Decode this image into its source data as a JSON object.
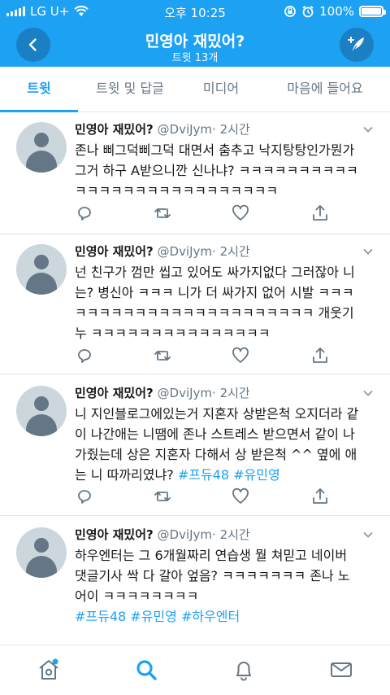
{
  "status_bar": {
    "carrier": "LG U+",
    "time": "오후 10:25",
    "battery": "100%",
    "battery_level": 1.0
  },
  "header": {
    "title": "민영아 재밌어?",
    "subtitle": "트윗 13개"
  },
  "tabs": [
    {
      "label": "트윗",
      "active": true
    },
    {
      "label": "트윗 및 답글",
      "active": false
    },
    {
      "label": "미디어",
      "active": false
    },
    {
      "label": "마음에 들어요",
      "active": false
    }
  ],
  "tweets": [
    {
      "name": "민영아 재밌어?",
      "handle": "@DviJym",
      "time": "· 2시간",
      "lines": [
        "존나 삐그덕삐그덕 대면서 춤추고 낙지탕탕인가뭔가",
        "그거 하구 A받으니깐 신나냐? ㅋㅋㅋㅋㅋㅋㅋㅋㅋㅋ",
        "ㅋㅋㅋㅋㅋㅋㅋㅋㅋㅋㅋㅋㅋㅋㅋㅋㅋ"
      ],
      "hashtags": ""
    },
    {
      "name": "민영아 재밌어?",
      "handle": "@DviJym",
      "time": "· 2시간",
      "lines": [
        "넌 친구가 껌만 씹고 있어도 싸가지없다 그러잖아 니",
        "는? 병신아 ㅋㅋㅋ 니가 더 싸가지 없어 시발 ㅋㅋㅋ",
        "ㅋㅋㅋㅋㅋㅋㅋㅋㅋㅋㅋㅋㅋㅋㅋㅋㅋㅋㅋㅋ 개웃기",
        "누 ㅋㅋㅋㅋㅋㅋㅋㅋㅋㅋㅋㅋㅋㅋㅋ"
      ],
      "hashtags": ""
    },
    {
      "name": "민영아 재밌어?",
      "handle": "@DviJym",
      "time": "· 2시간",
      "lines": [
        "니 지인블로그에있는거 지혼자 상받은척 오지더라 같",
        "이 나간애는 니땜에 존나 스트레스 받으면서 같이 나",
        "가줬는데 상은 지혼자 다해서 상 받은척 ^^  옆에 애",
        "는 니 따까리였냐?"
      ],
      "hashtags": "#프듀48 #유민영"
    },
    {
      "name": "민영아 재밌어?",
      "handle": "@DviJym",
      "time": "· 2시간",
      "lines": [
        "하우엔터는 그 6개월짜리 연습생 뭘 쳐믿고 네이버",
        "댓글기사 싹 다 갈아 엎음?  ㅋㅋㅋㅋㅋㅋㅋ 존나 노",
        "어이 ㅋㅋㅋㅋㅋㅋㅋㅋ"
      ],
      "hashtags": "#프듀48 #유민영 #하우엔터"
    }
  ],
  "colors": {
    "accent": "#1da1f2",
    "header_button": "#1b7fc3",
    "text_secondary": "#657786",
    "divider": "#e1e8ed"
  },
  "icons": {
    "back": "arrow-left-icon",
    "compose": "feather-plus-icon",
    "reply": "reply-icon",
    "retweet": "retweet-icon",
    "like": "heart-icon",
    "share": "share-icon",
    "home": "home-icon",
    "search": "search-icon",
    "notifications": "bell-icon",
    "messages": "mail-icon"
  }
}
